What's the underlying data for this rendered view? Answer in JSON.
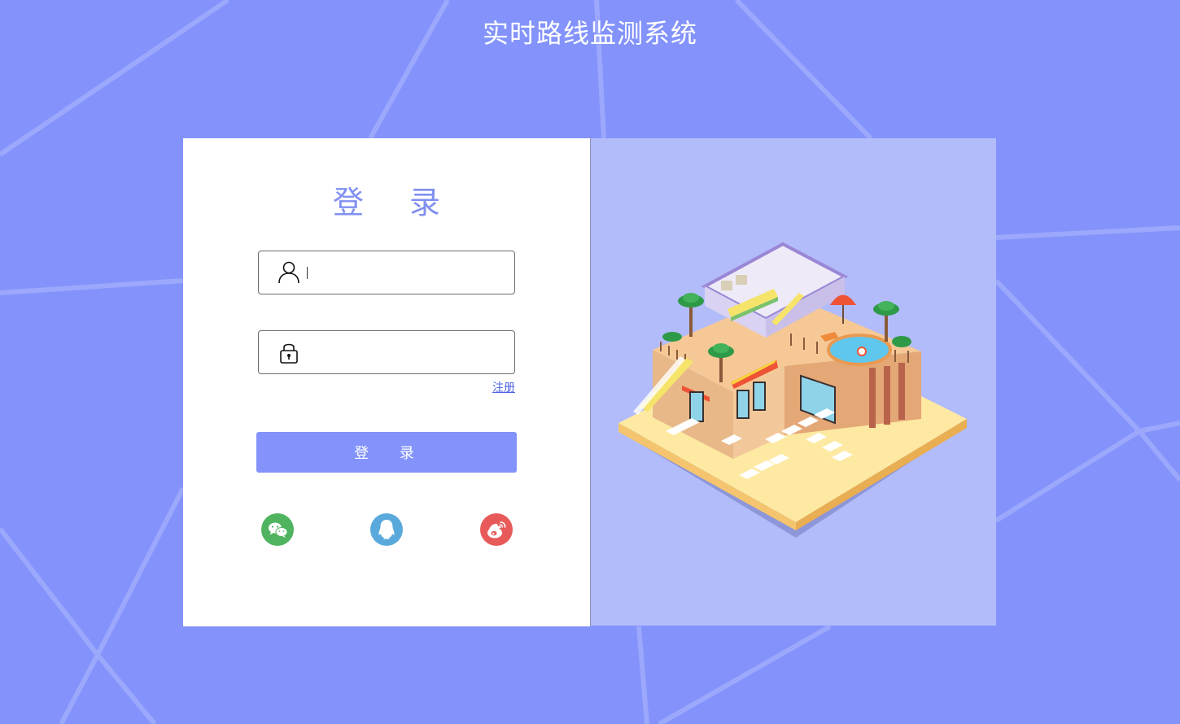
{
  "page": {
    "title": "实时路线监测系统"
  },
  "login": {
    "heading": "登 录",
    "username": {
      "value": "",
      "placeholder": ""
    },
    "password": {
      "value": "",
      "placeholder": ""
    },
    "register_link": "注册",
    "submit_label": "登 录",
    "social": [
      {
        "name": "wechat-icon",
        "color": "#4fb35f"
      },
      {
        "name": "qq-icon",
        "color": "#5aa9dc"
      },
      {
        "name": "weibo-icon",
        "color": "#e85a5a"
      }
    ]
  },
  "colors": {
    "background": "#8393fb",
    "illustration_panel": "#b2bcfa",
    "accent": "#8393fb",
    "heading": "#8190f0",
    "link": "#4e63e6"
  }
}
